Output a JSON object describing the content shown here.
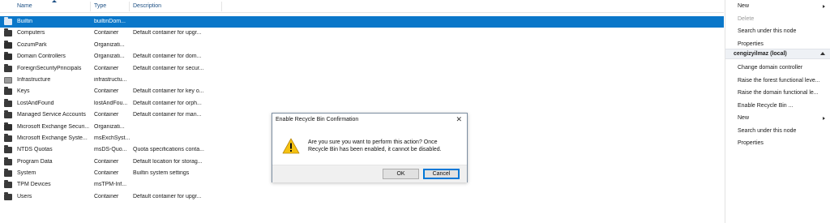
{
  "list": {
    "columns": {
      "name": "Name",
      "type": "Type",
      "description": "Description"
    },
    "rows": [
      {
        "name": "Builtin",
        "type": "builtinDom...",
        "description": "",
        "icon": "folder-icon",
        "selected": true
      },
      {
        "name": "Computers",
        "type": "Container",
        "description": "Default container for upgr...",
        "icon": "folder-icon"
      },
      {
        "name": "CozumPark",
        "type": "Organizati...",
        "description": "",
        "icon": "organizational-unit-icon"
      },
      {
        "name": "Domain Controllers",
        "type": "Organizati...",
        "description": "Default container for dom...",
        "icon": "organizational-unit-icon"
      },
      {
        "name": "ForeignSecurityPrincipals",
        "type": "Container",
        "description": "Default container for secur...",
        "icon": "folder-icon"
      },
      {
        "name": "Infrastructure",
        "type": "infrastructu...",
        "description": "",
        "icon": "infrastructure-icon"
      },
      {
        "name": "Keys",
        "type": "Container",
        "description": "Default container for key o...",
        "icon": "folder-icon"
      },
      {
        "name": "LostAndFound",
        "type": "lostAndFou...",
        "description": "Default container for orph...",
        "icon": "folder-icon"
      },
      {
        "name": "Managed Service Accounts",
        "type": "Container",
        "description": "Default container for man...",
        "icon": "folder-icon"
      },
      {
        "name": "Microsoft Exchange Securi...",
        "type": "Organizati...",
        "description": "",
        "icon": "organizational-unit-icon"
      },
      {
        "name": "Microsoft Exchange Syste...",
        "type": "msExchSyst...",
        "description": "",
        "icon": "folder-icon"
      },
      {
        "name": "NTDS Quotas",
        "type": "msDS-Quo...",
        "description": "Quota specifications conta...",
        "icon": "folder-icon"
      },
      {
        "name": "Program Data",
        "type": "Container",
        "description": "Default location for storag...",
        "icon": "folder-icon"
      },
      {
        "name": "System",
        "type": "Container",
        "description": "Builtin system settings",
        "icon": "folder-icon"
      },
      {
        "name": "TPM Devices",
        "type": "msTPM-Inf...",
        "description": "",
        "icon": "folder-icon"
      },
      {
        "name": "Users",
        "type": "Container",
        "description": "Default container for upgr...",
        "icon": "folder-icon"
      }
    ]
  },
  "actions": {
    "top": [
      {
        "label": "New",
        "has_submenu": true,
        "disabled": false
      },
      {
        "label": "Delete",
        "has_submenu": false,
        "disabled": true
      },
      {
        "label": "Search under this node",
        "has_submenu": false,
        "disabled": false
      },
      {
        "label": "Properties",
        "has_submenu": false,
        "disabled": false
      }
    ],
    "section_title": "cengizyilmaz (local)",
    "section": [
      {
        "label": "Change domain controller",
        "has_submenu": false
      },
      {
        "label": "Raise the forest functional leve...",
        "has_submenu": false
      },
      {
        "label": "Raise the domain functional le...",
        "has_submenu": false
      },
      {
        "label": "Enable Recycle Bin ...",
        "has_submenu": false
      },
      {
        "label": "New",
        "has_submenu": true
      },
      {
        "label": "Search under this node",
        "has_submenu": false
      },
      {
        "label": "Properties",
        "has_submenu": false
      }
    ]
  },
  "dialog": {
    "title": "Enable Recycle Bin Confirmation",
    "message": "Are you sure you want to perform this action? Once Recycle Bin has been enabled, it cannot be disabled.",
    "ok_label": "OK",
    "cancel_label": "Cancel",
    "icon": "warning-icon"
  },
  "colors": {
    "selection": "#0a77c9",
    "header_text": "#1c4f84",
    "warning": "#f5c211"
  }
}
